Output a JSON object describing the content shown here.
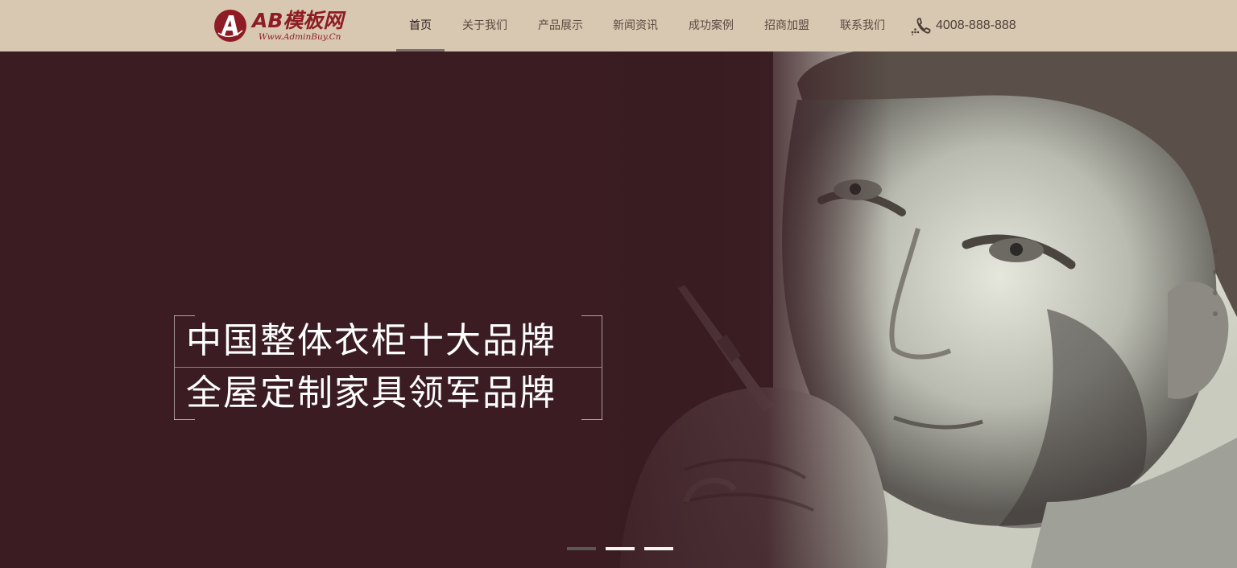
{
  "logo": {
    "brand": "AB模板网",
    "url_text": "Www.AdminBuy.Cn",
    "icon": "logo-a-mark",
    "color": "#8e1c24"
  },
  "nav": {
    "items": [
      {
        "label": "首页",
        "active": true
      },
      {
        "label": "关于我们",
        "active": false
      },
      {
        "label": "产品展示",
        "active": false
      },
      {
        "label": "新闻资讯",
        "active": false
      },
      {
        "label": "成功案例",
        "active": false
      },
      {
        "label": "招商加盟",
        "active": false
      },
      {
        "label": "联系我们",
        "active": false
      }
    ]
  },
  "phone": {
    "icon": "phone-icon",
    "number": "4008-888-888"
  },
  "hero": {
    "slogan_line1": "中国整体衣柜十大品牌",
    "slogan_line2": "全屋定制家具领军品牌",
    "carousel": {
      "count": 3,
      "active_index": 0
    }
  },
  "colors": {
    "header_bg": "#d9c8b1",
    "hero_bg": "#3a1c22",
    "brand_red": "#8e1c24"
  }
}
